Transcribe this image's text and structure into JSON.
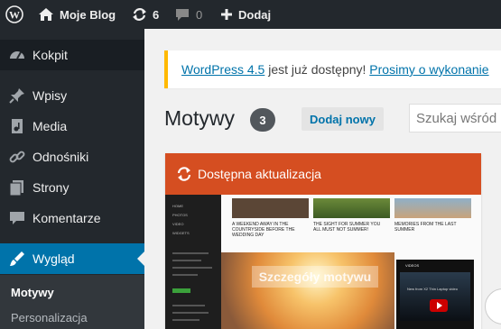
{
  "adminbar": {
    "site_name": "Moje Blog",
    "updates_count": "6",
    "comments_count": "0",
    "new_label": "Dodaj"
  },
  "sidebar": {
    "items": [
      {
        "label": "Kokpit",
        "icon": "dashboard-icon"
      },
      {
        "label": "Wpisy",
        "icon": "pin-icon"
      },
      {
        "label": "Media",
        "icon": "media-icon"
      },
      {
        "label": "Odnośniki",
        "icon": "link-icon"
      },
      {
        "label": "Strony",
        "icon": "pages-icon"
      },
      {
        "label": "Komentarze",
        "icon": "comment-icon"
      },
      {
        "label": "Wygląd",
        "icon": "brush-icon"
      }
    ],
    "submenu": [
      "Motywy",
      "Personalizacja"
    ]
  },
  "notice": {
    "link1": "WordPress 4.5",
    "text": " jest już dostępny! ",
    "link2": "Prosimy o wykonanie"
  },
  "page": {
    "title": "Motywy",
    "count": "3",
    "add_new": "Dodaj nowy",
    "search_placeholder": "Szukaj wśród"
  },
  "theme": {
    "update_label": "Dostępna aktualizacja",
    "overlay_text": "Szczegóły motywu",
    "preview": {
      "nav": [
        "HOME",
        "PHOTOS",
        "VIDEO",
        "WIDGETS"
      ],
      "posts": [
        "A WEEKEND AWAY IN THE COUNTRYSIDE BEFORE THE WEDDING DAY",
        "THE SIGHT FOR SUMMER YOU ALL MUST NOT SUMMER!",
        "MEMORIES FROM THE LAST SUMMER"
      ],
      "video_label": "VIDEOS",
      "video_title": "New from X2 Thin Laptop video"
    }
  },
  "colors": {
    "adminbar": "#23282d",
    "current": "#0073aa",
    "update": "#d54e21",
    "notice_border": "#ffb900"
  }
}
